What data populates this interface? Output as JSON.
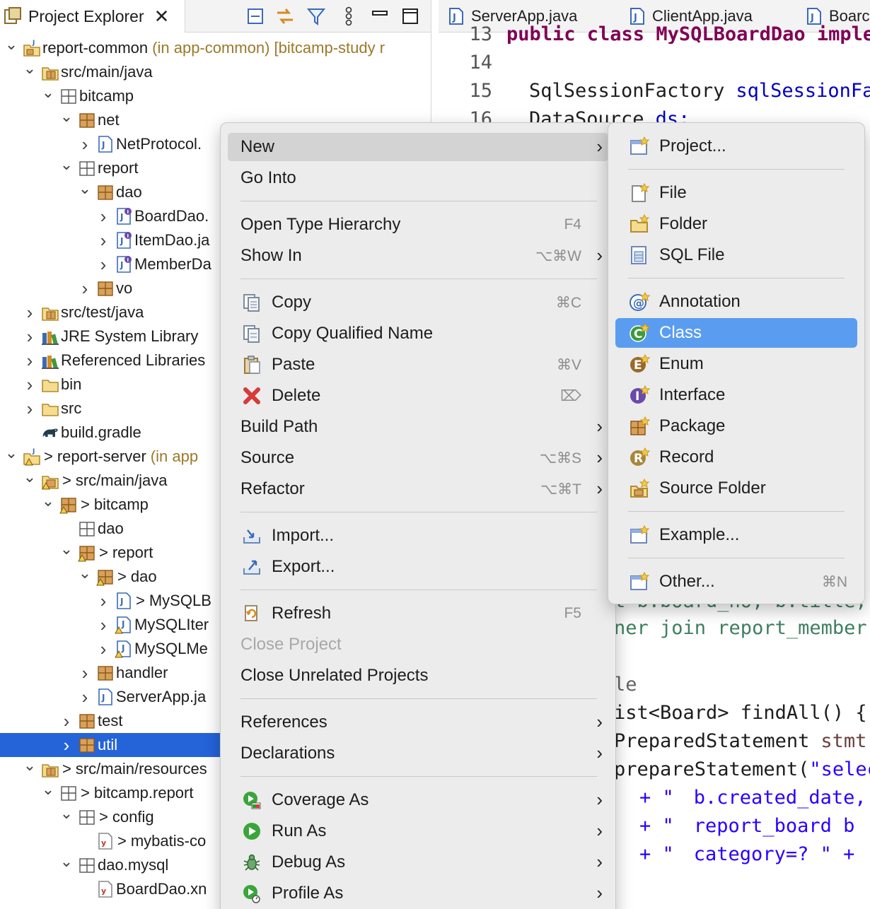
{
  "explorer": {
    "tab_title": "Project Explorer",
    "tree": [
      {
        "label": "report-common",
        "deco": "(in app-common) [bitcamp-study r"
      },
      {
        "label": "src/main/java"
      },
      {
        "label": "bitcamp"
      },
      {
        "label": "net"
      },
      {
        "label": "NetProtocol."
      },
      {
        "label": "report"
      },
      {
        "label": "dao"
      },
      {
        "label": "BoardDao."
      },
      {
        "label": "ItemDao.ja"
      },
      {
        "label": "MemberDa"
      },
      {
        "label": "vo"
      },
      {
        "label": "src/test/java"
      },
      {
        "label": "JRE System Library"
      },
      {
        "label": "Referenced Libraries"
      },
      {
        "label": "bin"
      },
      {
        "label": "src"
      },
      {
        "label": "build.gradle"
      },
      {
        "label": "report-server",
        "deco": "(in app"
      },
      {
        "label": "src/main/java"
      },
      {
        "label": "bitcamp"
      },
      {
        "label": "dao"
      },
      {
        "label": "report"
      },
      {
        "label": "dao"
      },
      {
        "label": "MySQLB"
      },
      {
        "label": "MySQLIter"
      },
      {
        "label": "MySQLMe"
      },
      {
        "label": "handler"
      },
      {
        "label": "ServerApp.ja"
      },
      {
        "label": "test"
      },
      {
        "label": "util"
      },
      {
        "label": "src/main/resources"
      },
      {
        "label": "bitcamp.report"
      },
      {
        "label": "config"
      },
      {
        "label": "mybatis-co"
      },
      {
        "label": "dao.mysql"
      },
      {
        "label": "BoardDao.xn"
      }
    ]
  },
  "editor": {
    "tabs": [
      "ServerApp.java",
      "ClientApp.java",
      "Boarc"
    ],
    "lines": {
      "l13": {
        "num": "13",
        "text": "public class MySQLBoardDao implem"
      },
      "l14": {
        "num": "14"
      },
      "l15": {
        "num": "15",
        "type": "SqlSessionFactory",
        "field": "sqlSessionFa"
      },
      "l16": {
        "num": "16",
        "type": "DataSource",
        "field": "ds;"
      },
      "r1": "ner join report_member r",
      "r2": "le",
      "r3": "ist<Board> findAll() {",
      "r4a": "PreparedStatement",
      "r4b": "stmt =",
      "r5a": "prepareStatement(",
      "r5b": "\"selec",
      "r6a": "+ \"",
      "r6b": "b.created_date,",
      "r7a": "+ \"",
      "r7b": "report_board b",
      "r8a": "+ \"",
      "r8b": "category=? \" +",
      "r0": "t b.board_no, b.title,"
    }
  },
  "context_menu": {
    "new": "New",
    "go_into": "Go Into",
    "open_type_hierarchy": "Open Type Hierarchy",
    "open_type_hierarchy_shortcut": "F4",
    "show_in": "Show In",
    "show_in_shortcut": "⌥⌘W",
    "copy": "Copy",
    "copy_shortcut": "⌘C",
    "copy_qualified_name": "Copy Qualified Name",
    "paste": "Paste",
    "paste_shortcut": "⌘V",
    "delete": "Delete",
    "delete_shortcut": "⌦",
    "build_path": "Build Path",
    "source": "Source",
    "source_shortcut": "⌥⌘S",
    "refactor": "Refactor",
    "refactor_shortcut": "⌥⌘T",
    "import": "Import...",
    "export": "Export...",
    "refresh": "Refresh",
    "refresh_shortcut": "F5",
    "close_project": "Close Project",
    "close_unrelated": "Close Unrelated Projects",
    "references": "References",
    "declarations": "Declarations",
    "coverage_as": "Coverage As",
    "run_as": "Run As",
    "debug_as": "Debug As",
    "profile_as": "Profile As"
  },
  "submenu": {
    "project": "Project...",
    "file": "File",
    "folder": "Folder",
    "sql_file": "SQL File",
    "annotation": "Annotation",
    "class": "Class",
    "enum": "Enum",
    "interface": "Interface",
    "package": "Package",
    "record": "Record",
    "source_folder": "Source Folder",
    "example": "Example...",
    "other": "Other...",
    "other_shortcut": "⌘N"
  },
  "colors": {
    "selection": "#2563d9",
    "submenu_active": "#5a9df0",
    "menu_bg": "#ececec",
    "keyword": "#7f0055",
    "field": "#0000c0",
    "string": "#2a00ff"
  }
}
